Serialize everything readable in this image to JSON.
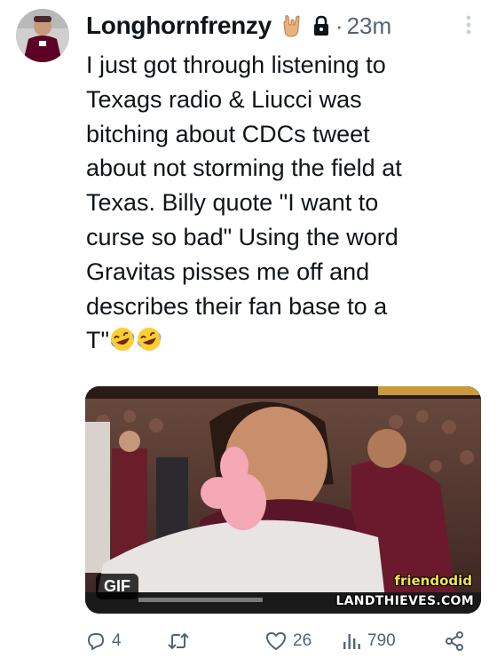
{
  "author": {
    "display_name": "Longhornfrenzy",
    "time": "23m",
    "separator": "·"
  },
  "icons": {
    "horns": "horns-hand-emoji",
    "protected": "lock-icon",
    "more": "more-vertical-icon",
    "laugh": "rolling-on-floor-laughing-emoji",
    "reply": "reply-icon",
    "retweet": "retweet-icon",
    "like": "heart-icon",
    "views": "views-icon",
    "share": "share-icon"
  },
  "tweet": {
    "text": "I just got through listening to\nTexags radio & Liucci was\nbitching about CDCs tweet\nabout not storming the field at\nTexas. Billy quote \"I want to\ncurse so bad\" Using the word\nGravitas pisses me off and\ndescribes their fan base to a\nT\""
  },
  "media": {
    "badge": "GIF",
    "watermark_line1": "friendodid",
    "watermark_line2": "LANDTHIEVES.COM"
  },
  "stats": {
    "replies": "4",
    "likes": "26",
    "views": "790"
  },
  "colors": {
    "text": "#0f1419",
    "secondary": "#536471",
    "maroon": "#5c0025"
  }
}
